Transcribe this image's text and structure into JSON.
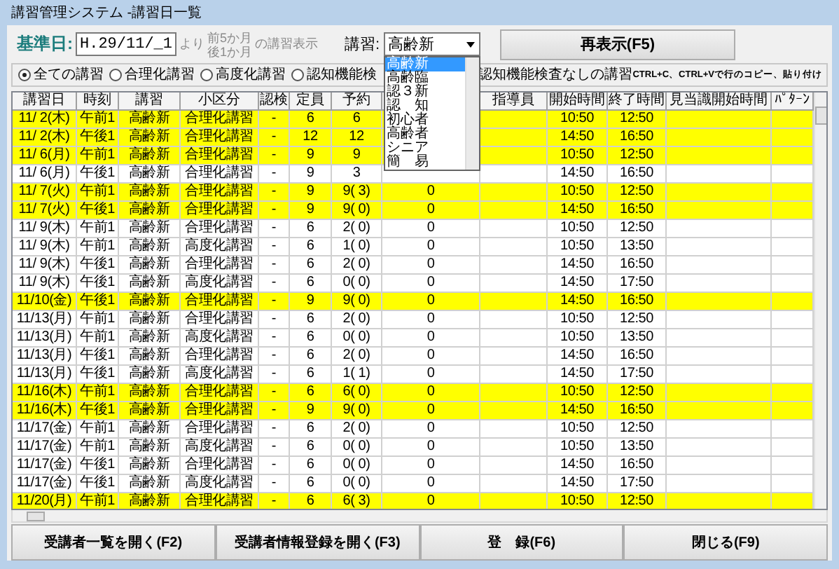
{
  "window": {
    "title": "講習管理システム -講習日一覧"
  },
  "filter": {
    "base_date_label": "基準日:",
    "base_date": "H.29/11/_1",
    "from_text": "より",
    "range_before": "前5か月",
    "range_after": "後1か月",
    "range_suffix": "の講習表示",
    "course_label": "講習:",
    "course_value": "高齢新",
    "refresh_button": "再表示(F5)"
  },
  "course_options": [
    {
      "label": "高齢新",
      "selected": true
    },
    {
      "label": "高齢臨",
      "selected": false
    },
    {
      "label": "認３新",
      "selected": false
    },
    {
      "label": "認　知",
      "selected": false
    },
    {
      "label": "初心者",
      "selected": false
    },
    {
      "label": "高齢者",
      "selected": false
    },
    {
      "label": "シニア",
      "selected": false
    },
    {
      "label": "簡　易",
      "selected": false
    }
  ],
  "radios": [
    {
      "label": "全ての講習",
      "selected": true
    },
    {
      "label": "合理化講習",
      "selected": false
    },
    {
      "label": "高度化講習",
      "selected": false
    },
    {
      "label": "認知機能検",
      "selected": false
    }
  ],
  "radio_tail": "認知機能検査なしの講習",
  "hint": "CTRL+C、CTRL+Vで行のコピー、貼り付け",
  "table": {
    "columns": [
      "講習日",
      "時刻",
      "講習",
      "小区分",
      "認検",
      "定員",
      "予約",
      null,
      "指導員",
      "開始時間",
      "終了時間",
      "見当識開始時間",
      "ﾊﾟﾀｰﾝ"
    ],
    "rows": [
      {
        "highlighted": true,
        "cells": [
          "11/ 2(木)",
          "午前1",
          "高齢新",
          "合理化講習",
          "-",
          "6",
          "6",
          null,
          null,
          "10:50",
          "12:50",
          null,
          null
        ]
      },
      {
        "highlighted": true,
        "cells": [
          "11/ 2(木)",
          "午後1",
          "高齢新",
          "合理化講習",
          "-",
          "12",
          "12",
          null,
          null,
          "14:50",
          "16:50",
          null,
          null
        ]
      },
      {
        "highlighted": true,
        "cells": [
          "11/ 6(月)",
          "午前1",
          "高齢新",
          "合理化講習",
          "-",
          "9",
          "9",
          null,
          null,
          "10:50",
          "12:50",
          null,
          null
        ]
      },
      {
        "highlighted": false,
        "cells": [
          "11/ 6(月)",
          "午後1",
          "高齢新",
          "合理化講習",
          "-",
          "9",
          "3",
          null,
          null,
          "14:50",
          "16:50",
          null,
          null
        ]
      },
      {
        "highlighted": true,
        "cells": [
          "11/ 7(火)",
          "午前1",
          "高齢新",
          "合理化講習",
          "-",
          "9",
          "9( 3)",
          "0",
          null,
          "10:50",
          "12:50",
          null,
          null
        ]
      },
      {
        "highlighted": true,
        "cells": [
          "11/ 7(火)",
          "午後1",
          "高齢新",
          "合理化講習",
          "-",
          "9",
          "9( 0)",
          "0",
          null,
          "14:50",
          "16:50",
          null,
          null
        ]
      },
      {
        "highlighted": false,
        "cells": [
          "11/ 9(木)",
          "午前1",
          "高齢新",
          "合理化講習",
          "-",
          "6",
          "2( 0)",
          "0",
          null,
          "10:50",
          "12:50",
          null,
          null
        ]
      },
      {
        "highlighted": false,
        "cells": [
          "11/ 9(木)",
          "午前1",
          "高齢新",
          "高度化講習",
          "-",
          "6",
          "1( 0)",
          "0",
          null,
          "10:50",
          "13:50",
          null,
          null
        ]
      },
      {
        "highlighted": false,
        "cells": [
          "11/ 9(木)",
          "午後1",
          "高齢新",
          "合理化講習",
          "-",
          "6",
          "2( 0)",
          "0",
          null,
          "14:50",
          "16:50",
          null,
          null
        ]
      },
      {
        "highlighted": false,
        "cells": [
          "11/ 9(木)",
          "午後1",
          "高齢新",
          "高度化講習",
          "-",
          "6",
          "0( 0)",
          "0",
          null,
          "14:50",
          "17:50",
          null,
          null
        ]
      },
      {
        "highlighted": true,
        "cells": [
          "11/10(金)",
          "午後1",
          "高齢新",
          "合理化講習",
          "-",
          "9",
          "9( 0)",
          "0",
          null,
          "14:50",
          "16:50",
          null,
          null
        ]
      },
      {
        "highlighted": false,
        "cells": [
          "11/13(月)",
          "午前1",
          "高齢新",
          "合理化講習",
          "-",
          "6",
          "2( 0)",
          "0",
          null,
          "10:50",
          "12:50",
          null,
          null
        ]
      },
      {
        "highlighted": false,
        "cells": [
          "11/13(月)",
          "午前1",
          "高齢新",
          "高度化講習",
          "-",
          "6",
          "0( 0)",
          "0",
          null,
          "10:50",
          "13:50",
          null,
          null
        ]
      },
      {
        "highlighted": false,
        "cells": [
          "11/13(月)",
          "午後1",
          "高齢新",
          "合理化講習",
          "-",
          "6",
          "2( 0)",
          "0",
          null,
          "14:50",
          "16:50",
          null,
          null
        ]
      },
      {
        "highlighted": false,
        "cells": [
          "11/13(月)",
          "午後1",
          "高齢新",
          "高度化講習",
          "-",
          "6",
          "1( 1)",
          "0",
          null,
          "14:50",
          "17:50",
          null,
          null
        ]
      },
      {
        "highlighted": true,
        "cells": [
          "11/16(木)",
          "午前1",
          "高齢新",
          "合理化講習",
          "-",
          "6",
          "6( 0)",
          "0",
          null,
          "10:50",
          "12:50",
          null,
          null
        ]
      },
      {
        "highlighted": true,
        "cells": [
          "11/16(木)",
          "午後1",
          "高齢新",
          "合理化講習",
          "-",
          "9",
          "9( 0)",
          "0",
          null,
          "14:50",
          "16:50",
          null,
          null
        ]
      },
      {
        "highlighted": false,
        "cells": [
          "11/17(金)",
          "午前1",
          "高齢新",
          "合理化講習",
          "-",
          "6",
          "2( 0)",
          "0",
          null,
          "10:50",
          "12:50",
          null,
          null
        ]
      },
      {
        "highlighted": false,
        "cells": [
          "11/17(金)",
          "午前1",
          "高齢新",
          "高度化講習",
          "-",
          "6",
          "0( 0)",
          "0",
          null,
          "10:50",
          "13:50",
          null,
          null
        ]
      },
      {
        "highlighted": false,
        "cells": [
          "11/17(金)",
          "午後1",
          "高齢新",
          "合理化講習",
          "-",
          "6",
          "0( 0)",
          "0",
          null,
          "14:50",
          "16:50",
          null,
          null
        ]
      },
      {
        "highlighted": false,
        "cells": [
          "11/17(金)",
          "午後1",
          "高齢新",
          "高度化講習",
          "-",
          "6",
          "0( 0)",
          "0",
          null,
          "14:50",
          "17:50",
          null,
          null
        ]
      },
      {
        "highlighted": true,
        "cells": [
          "11/20(月)",
          "午前1",
          "高齢新",
          "合理化講習",
          "-",
          "6",
          "6( 3)",
          "0",
          null,
          "10:50",
          "12:50",
          null,
          null
        ]
      }
    ]
  },
  "buttons": [
    "受講者一覧を開く(F2)",
    "受講者情報登録を開く(F3)",
    "登　録(F6)",
    "閉じる(F9)"
  ]
}
